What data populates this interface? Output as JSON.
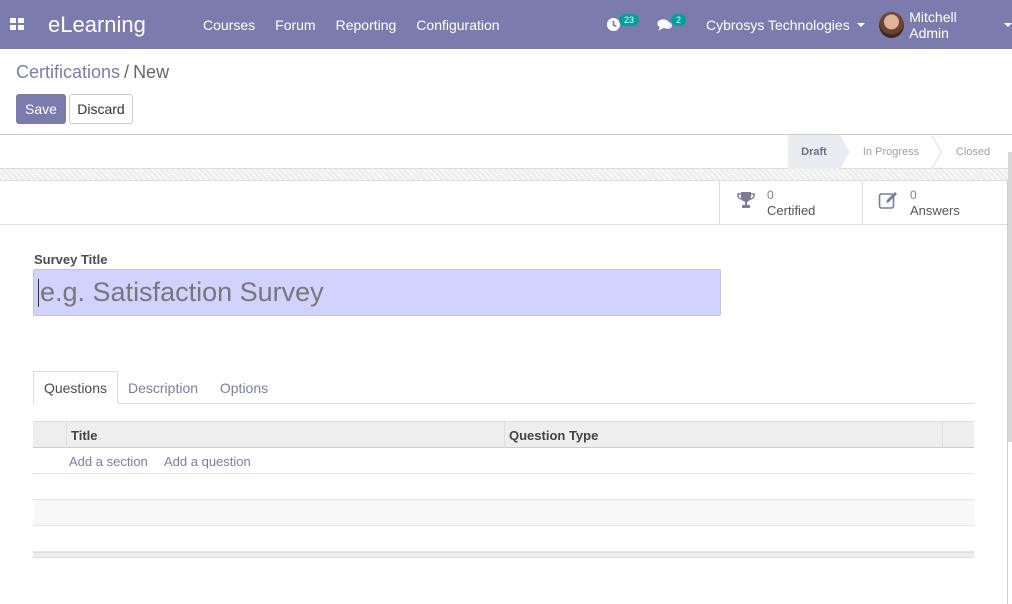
{
  "navbar": {
    "brand": "eLearning",
    "menu": [
      "Courses",
      "Forum",
      "Reporting",
      "Configuration"
    ],
    "activity_count": "23",
    "message_count": "2",
    "company": "Cybrosys Technologies",
    "user": "Mitchell Admin",
    "colors": {
      "bar": "#7c7bad",
      "badge": "#00a09d"
    }
  },
  "breadcrumb": {
    "parent": "Certifications",
    "separator": "/",
    "current": "New"
  },
  "buttons": {
    "save": "Save",
    "discard": "Discard"
  },
  "statusbar": {
    "stages": [
      "Draft",
      "In Progress",
      "Closed"
    ],
    "active": "Draft"
  },
  "stat_buttons": {
    "certified": {
      "value": "0",
      "label": "Certified",
      "icon": "trophy-icon"
    },
    "answers": {
      "value": "0",
      "label": "Answers",
      "icon": "edit-icon"
    }
  },
  "form": {
    "title_label": "Survey Title",
    "title_placeholder": "e.g. Satisfaction Survey"
  },
  "tabs": {
    "questions": "Questions",
    "description": "Description",
    "options": "Options",
    "active": "Questions"
  },
  "table": {
    "columns": [
      "Title",
      "Question Type"
    ],
    "add_section": "Add a section",
    "add_question": "Add a question"
  }
}
